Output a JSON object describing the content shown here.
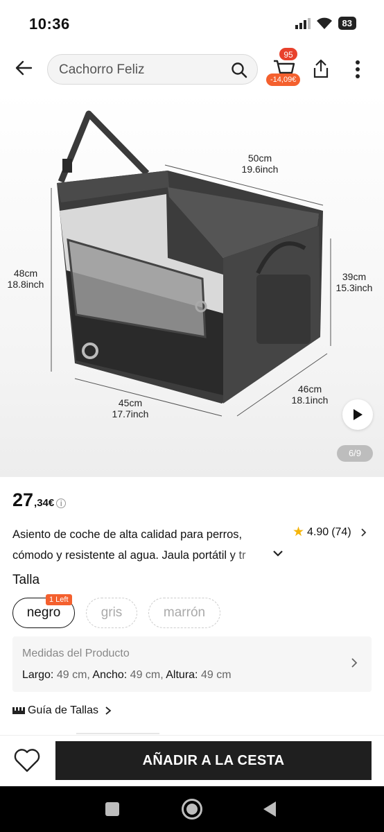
{
  "status_bar": {
    "time": "10:36",
    "battery": "83"
  },
  "search": {
    "query": "Cachorro Feliz"
  },
  "cart": {
    "badge_count": "95",
    "discount": "-14,09€"
  },
  "image": {
    "dims": {
      "top_cm": "50cm",
      "top_inch": "19.6inch",
      "left_cm": "48cm",
      "left_inch": "18.8inch",
      "right_cm": "39cm",
      "right_inch": "15.3inch",
      "bottom_left_cm": "45cm",
      "bottom_left_inch": "17.7inch",
      "bottom_right_cm": "46cm",
      "bottom_right_inch": "18.1inch"
    },
    "page_indicator": "6/9"
  },
  "product": {
    "price_int": "27",
    "price_dec": ",34€",
    "title_line1": "Asiento de coche de alta calidad para perros,",
    "title_line2": "cómodo y resistente al agua. Jaula portátil y tr",
    "rating": "4.90",
    "rating_count": "(74)"
  },
  "size": {
    "label": "Talla",
    "options": [
      "negro",
      "gris",
      "marrón"
    ],
    "left_badge": "1 Left"
  },
  "measurements": {
    "title": "Medidas del Producto",
    "largo_label": "Largo:",
    "largo_value": "49 cm,",
    "ancho_label": "Ancho:",
    "ancho_value": "49 cm,",
    "altura_label": "Altura:",
    "altura_value": "49 cm"
  },
  "size_guide": "Guía de Tallas",
  "actions": {
    "add_to_cart": "AÑADIR A LA CESTA"
  },
  "colors": {
    "accent": "#f4602e",
    "badge": "#e8412c",
    "button": "#1f1f1f",
    "star": "#f5b50a"
  }
}
